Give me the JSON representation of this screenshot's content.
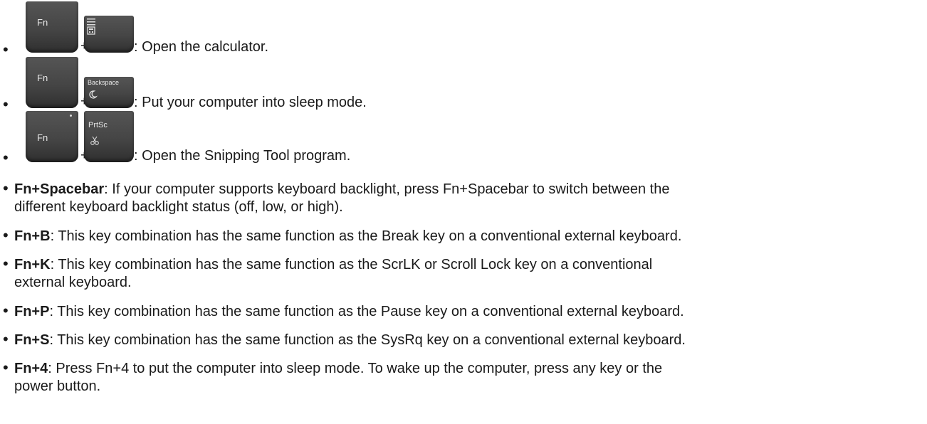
{
  "key_items": [
    {
      "fn_label": "Fn",
      "second_key": "calculator",
      "second_label": "",
      "plus": "+",
      "description": ": Open the calculator."
    },
    {
      "fn_label": "Fn",
      "second_key": "sleep",
      "second_label": "Backspace",
      "plus": "+",
      "description": ": Put your computer into sleep mode."
    },
    {
      "fn_label": "Fn",
      "second_key": "snipping",
      "second_label": "PrtSc",
      "plus": "+",
      "description": ": Open the Snipping Tool program."
    }
  ],
  "text_items": [
    {
      "key": "Fn+Spacebar",
      "text": ": If your computer supports keyboard backlight, press Fn+Spacebar to switch between the",
      "text2": "different keyboard backlight status (off, low, or high)."
    },
    {
      "key": "Fn+B",
      "text": ": This key combination has the same function as the Break key on a conventional external keyboard.",
      "text2": ""
    },
    {
      "key": "Fn+K",
      "text": ": This key combination has the same function as the ScrLK or Scroll Lock key on a conventional",
      "text2": "external keyboard."
    },
    {
      "key": "Fn+P",
      "text": ": This key combination has the same function as the Pause key on a conventional external keyboard.",
      "text2": ""
    },
    {
      "key": "Fn+S",
      "text": ": This key combination has the same function as the SysRq key on a conventional external keyboard.",
      "text2": ""
    },
    {
      "key": "Fn+4",
      "text": ": Press Fn+4 to put the computer into sleep mode. To wake up the computer, press any key or the",
      "text2": "power button."
    }
  ],
  "icons": {
    "calculator": "calculator-icon",
    "sleep": "moon-icon",
    "snipping": "snip-icon"
  }
}
